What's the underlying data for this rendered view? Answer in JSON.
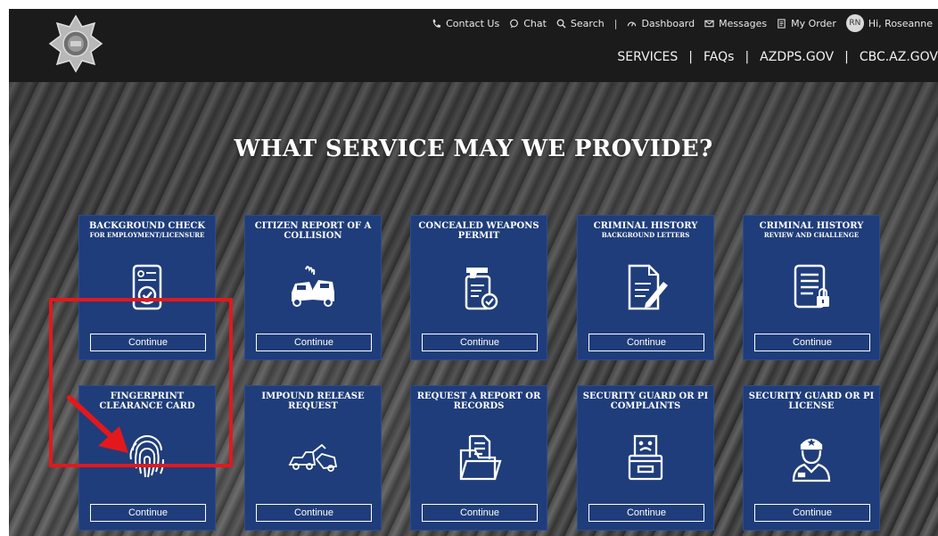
{
  "header": {
    "utility": {
      "contact": "Contact Us",
      "chat": "Chat",
      "search": "Search",
      "sep": "|",
      "dashboard": "Dashboard",
      "messages": "Messages",
      "order": "My Order",
      "avatar_initials": "RN",
      "greeting": "Hi, Roseanne"
    },
    "nav": {
      "services": "SERVICES",
      "faqs": "FAQs",
      "azdps": "AZDPS.GOV",
      "cbc": "CBC.AZ.GOV",
      "sep": "|"
    }
  },
  "hero": {
    "title": "WHAT SERVICE MAY WE PROVIDE?"
  },
  "cards": [
    {
      "title": "BACKGROUND CHECK",
      "subtitle": "FOR EMPLOYMENT/LICENSURE",
      "icon": "background-check-icon",
      "button": "Continue"
    },
    {
      "title": "CITIZEN REPORT OF A COLLISION",
      "subtitle": "",
      "icon": "car-collision-icon",
      "button": "Continue"
    },
    {
      "title": "CONCEALED WEAPONS PERMIT",
      "subtitle": "",
      "icon": "weapon-permit-icon",
      "button": "Continue"
    },
    {
      "title": "CRIMINAL HISTORY",
      "subtitle": "BACKGROUND LETTERS",
      "icon": "document-pen-icon",
      "button": "Continue"
    },
    {
      "title": "CRIMINAL HISTORY",
      "subtitle": "REVIEW AND CHALLENGE",
      "icon": "locked-document-icon",
      "button": "Continue"
    },
    {
      "title": "FINGERPRINT CLEARANCE CARD",
      "subtitle": "",
      "icon": "fingerprint-icon",
      "button": "Continue"
    },
    {
      "title": "IMPOUND RELEASE REQUEST",
      "subtitle": "",
      "icon": "tow-truck-icon",
      "button": "Continue"
    },
    {
      "title": "REQUEST A REPORT OR RECORDS",
      "subtitle": "",
      "icon": "folder-document-icon",
      "button": "Continue"
    },
    {
      "title": "SECURITY GUARD OR PI COMPLAINTS",
      "subtitle": "",
      "icon": "complaint-box-icon",
      "button": "Continue"
    },
    {
      "title": "SECURITY GUARD OR PI LICENSE",
      "subtitle": "",
      "icon": "security-guard-icon",
      "button": "Continue"
    }
  ],
  "colors": {
    "header_bg": "#1b1b1b",
    "card_bg": "#1f3d7a",
    "highlight": "#e3181c"
  }
}
